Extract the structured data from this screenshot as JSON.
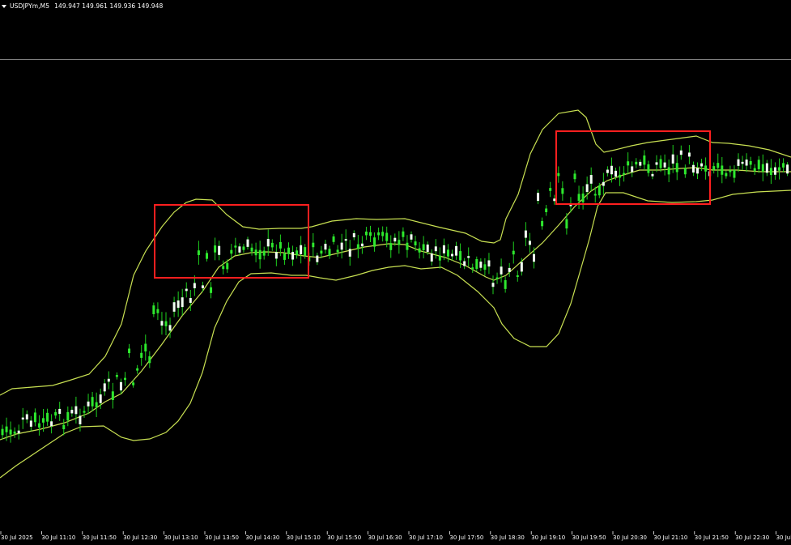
{
  "header": {
    "symbol": "USDJPYm,M5",
    "prices": "149.947 149.961 149.936 149.948"
  },
  "colors": {
    "background": "#000000",
    "bollinger": "#c8e052",
    "candle_bull": "#f2fff2",
    "candle_bear": "#2ee82e",
    "wick": "#1ecf1e",
    "highlight_box": "#ff1f1f",
    "separator": "#7f7f7f"
  },
  "chart_data": {
    "type": "candlestick",
    "indicator": "Bollinger Bands",
    "x_ticks": [
      "30 Jul 2025",
      "30 Jul 11:10",
      "30 Jul 11:50",
      "30 Jul 12:30",
      "30 Jul 13:10",
      "30 Jul 13:50",
      "30 Jul 14:30",
      "30 Jul 15:10",
      "30 Jul 15:50",
      "30 Jul 16:30",
      "30 Jul 17:10",
      "30 Jul 17:50",
      "30 Jul 18:30",
      "30 Jul 19:10",
      "30 Jul 19:50",
      "30 Jul 20:30",
      "30 Jul 21:10",
      "30 Jul 21:50",
      "30 Jul 22:30",
      "30 Jul"
    ],
    "bands": {
      "upper": [
        [
          0,
          488
        ],
        [
          15,
          480
        ],
        [
          40,
          478
        ],
        [
          65,
          476
        ],
        [
          85,
          470
        ],
        [
          110,
          462
        ],
        [
          130,
          440
        ],
        [
          150,
          400
        ],
        [
          165,
          340
        ],
        [
          180,
          310
        ],
        [
          200,
          280
        ],
        [
          215,
          262
        ],
        [
          230,
          250
        ],
        [
          242,
          246
        ],
        [
          262,
          247
        ],
        [
          280,
          265
        ],
        [
          300,
          280
        ],
        [
          320,
          283
        ],
        [
          345,
          282
        ],
        [
          372,
          282
        ],
        [
          385,
          280
        ],
        [
          410,
          273
        ],
        [
          440,
          270
        ],
        [
          465,
          271
        ],
        [
          500,
          270
        ],
        [
          540,
          280
        ],
        [
          575,
          288
        ],
        [
          595,
          298
        ],
        [
          610,
          300
        ],
        [
          618,
          296
        ],
        [
          625,
          270
        ],
        [
          640,
          240
        ],
        [
          655,
          190
        ],
        [
          670,
          160
        ],
        [
          690,
          140
        ],
        [
          714,
          136
        ],
        [
          724,
          145
        ],
        [
          736,
          178
        ],
        [
          746,
          188
        ],
        [
          760,
          185
        ],
        [
          780,
          180
        ],
        [
          800,
          176
        ],
        [
          830,
          172
        ],
        [
          860,
          168
        ],
        [
          880,
          176
        ],
        [
          900,
          177
        ],
        [
          925,
          180
        ],
        [
          950,
          185
        ],
        [
          977,
          194
        ]
      ],
      "middle": [
        [
          0,
          543
        ],
        [
          20,
          536
        ],
        [
          50,
          530
        ],
        [
          80,
          522
        ],
        [
          110,
          510
        ],
        [
          130,
          496
        ],
        [
          150,
          486
        ],
        [
          175,
          458
        ],
        [
          200,
          425
        ],
        [
          225,
          390
        ],
        [
          250,
          360
        ],
        [
          270,
          330
        ],
        [
          290,
          316
        ],
        [
          310,
          312
        ],
        [
          330,
          311
        ],
        [
          350,
          312
        ],
        [
          375,
          316
        ],
        [
          395,
          318
        ],
        [
          420,
          312
        ],
        [
          450,
          305
        ],
        [
          480,
          301
        ],
        [
          500,
          302
        ],
        [
          520,
          310
        ],
        [
          550,
          318
        ],
        [
          575,
          328
        ],
        [
          600,
          342
        ],
        [
          610,
          346
        ],
        [
          625,
          340
        ],
        [
          645,
          322
        ],
        [
          670,
          300
        ],
        [
          690,
          278
        ],
        [
          710,
          255
        ],
        [
          730,
          236
        ],
        [
          750,
          223
        ],
        [
          770,
          216
        ],
        [
          790,
          210
        ],
        [
          815,
          210
        ],
        [
          840,
          208
        ],
        [
          860,
          207
        ],
        [
          880,
          210
        ],
        [
          910,
          210
        ],
        [
          940,
          212
        ],
        [
          977,
          212
        ]
      ],
      "lower": [
        [
          0,
          590
        ],
        [
          20,
          575
        ],
        [
          50,
          555
        ],
        [
          80,
          535
        ],
        [
          100,
          527
        ],
        [
          128,
          526
        ],
        [
          150,
          540
        ],
        [
          165,
          544
        ],
        [
          185,
          542
        ],
        [
          205,
          534
        ],
        [
          220,
          520
        ],
        [
          235,
          498
        ],
        [
          250,
          460
        ],
        [
          265,
          405
        ],
        [
          280,
          372
        ],
        [
          295,
          348
        ],
        [
          310,
          338
        ],
        [
          335,
          337
        ],
        [
          360,
          340
        ],
        [
          378,
          340
        ],
        [
          395,
          343
        ],
        [
          415,
          346
        ],
        [
          440,
          340
        ],
        [
          460,
          334
        ],
        [
          480,
          330
        ],
        [
          500,
          328
        ],
        [
          520,
          332
        ],
        [
          545,
          330
        ],
        [
          565,
          340
        ],
        [
          590,
          360
        ],
        [
          610,
          380
        ],
        [
          620,
          400
        ],
        [
          635,
          418
        ],
        [
          655,
          428
        ],
        [
          675,
          428
        ],
        [
          690,
          412
        ],
        [
          705,
          375
        ],
        [
          718,
          330
        ],
        [
          728,
          295
        ],
        [
          738,
          255
        ],
        [
          748,
          238
        ],
        [
          770,
          238
        ],
        [
          800,
          248
        ],
        [
          830,
          250
        ],
        [
          860,
          249
        ],
        [
          880,
          247
        ],
        [
          905,
          240
        ],
        [
          935,
          237
        ],
        [
          977,
          235
        ]
      ]
    },
    "highlight_boxes": [
      "session-box-1",
      "session-box-2"
    ]
  }
}
